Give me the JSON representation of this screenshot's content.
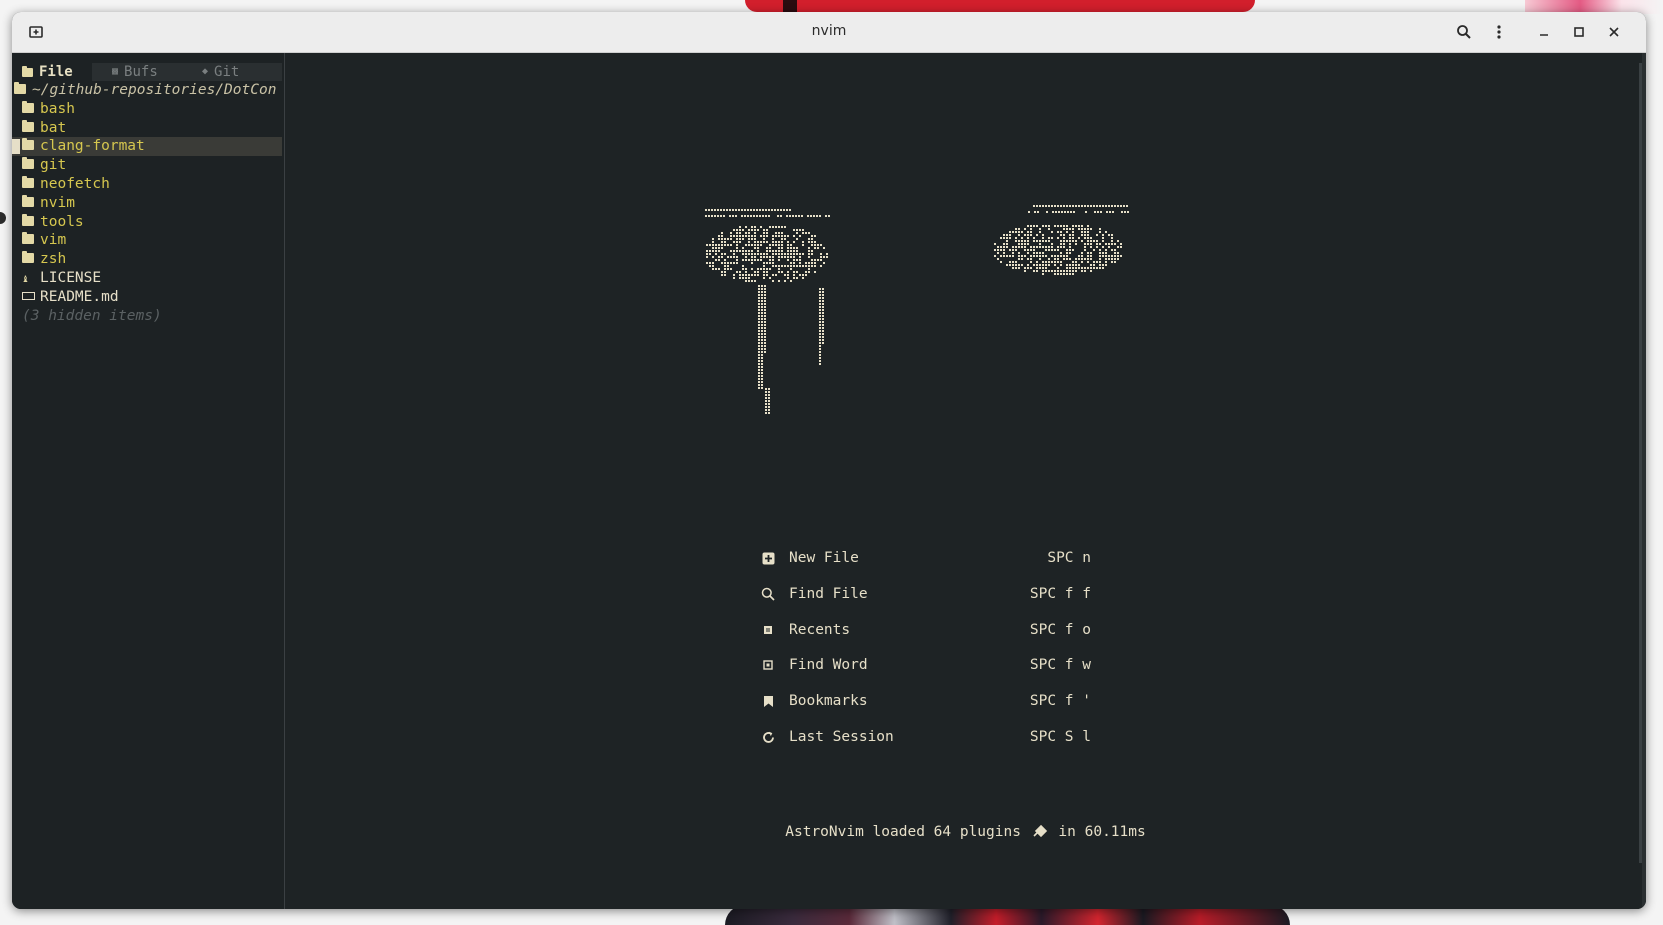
{
  "window": {
    "title": "nvim"
  },
  "tree": {
    "tabs": [
      {
        "label": "File",
        "icon": "folder-icon",
        "active": true
      },
      {
        "label": "Bufs",
        "icon": "buffers-icon",
        "active": false
      },
      {
        "label": "Git",
        "icon": "git-icon",
        "active": false
      }
    ],
    "root": "~/github-repositories/DotCon",
    "dirs": [
      "bash",
      "bat",
      "clang-format",
      "git",
      "neofetch",
      "nvim",
      "tools",
      "vim",
      "zsh"
    ],
    "selected": "clang-format",
    "files": [
      {
        "name": "LICENSE",
        "icon": "license-icon"
      },
      {
        "name": "README.md",
        "icon": "markdown-icon"
      }
    ],
    "hidden_note": "(3 hidden items)"
  },
  "dashboard": {
    "menu": [
      {
        "label": "New File",
        "key": "SPC n",
        "icon": "new-file-icon"
      },
      {
        "label": "Find File",
        "key": "SPC f f",
        "icon": "search-icon"
      },
      {
        "label": "Recents",
        "key": "SPC f o",
        "icon": "recents-icon"
      },
      {
        "label": "Find Word",
        "key": "SPC f w",
        "icon": "find-word-icon"
      },
      {
        "label": "Bookmarks",
        "key": "SPC f '",
        "icon": "bookmark-icon"
      },
      {
        "label": "Last Session",
        "key": "SPC S l",
        "icon": "refresh-icon"
      }
    ],
    "footer_pre": "AstroNvim loaded 64 plugins",
    "footer_post": "in 60.11ms",
    "text_color": "#e6dfc8",
    "accent_color": "#d6c74f"
  }
}
